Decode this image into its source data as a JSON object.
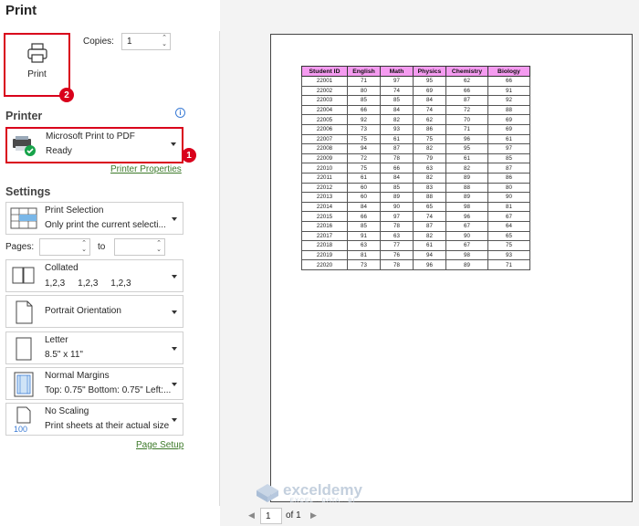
{
  "header": {
    "title": "Print"
  },
  "print_button": {
    "label": "Print"
  },
  "badges": {
    "b1": "1",
    "b2": "2"
  },
  "copies": {
    "label": "Copies:",
    "value": "1"
  },
  "printer": {
    "section": "Printer",
    "name": "Microsoft Print to PDF",
    "status": "Ready",
    "properties_link": "Printer Properties"
  },
  "settings": {
    "section": "Settings",
    "selection": {
      "title": "Print Selection",
      "subtitle": "Only print the current selecti..."
    },
    "pages": {
      "label": "Pages:",
      "to": "to",
      "from_value": "",
      "to_value": ""
    },
    "collation": {
      "title": "Collated",
      "subtitle": "1,2,3     1,2,3     1,2,3"
    },
    "orientation": {
      "title": "Portrait Orientation"
    },
    "paper": {
      "title": "Letter",
      "subtitle": "8.5\" x 11\""
    },
    "margins": {
      "title": "Normal Margins",
      "subtitle": "Top: 0.75\" Bottom: 0.75\" Left:..."
    },
    "scaling": {
      "title": "No Scaling",
      "subtitle": "Print sheets at their actual size",
      "icon_text": "100"
    },
    "page_setup_link": "Page Setup"
  },
  "pager": {
    "current": "1",
    "of_label": "of 1"
  },
  "watermark": {
    "brand": "exceldemy",
    "tagline": "EXCEL · DATA · BI"
  },
  "colors": {
    "accent_red": "#d9001b",
    "header_fill": "#f59bf0",
    "link_green": "#3d7a2a"
  },
  "table": {
    "headers": [
      "Student ID",
      "English",
      "Math",
      "Physics",
      "Chemistry",
      "Biology"
    ],
    "rows": [
      [
        "22001",
        "71",
        "97",
        "95",
        "62",
        "66"
      ],
      [
        "22002",
        "80",
        "74",
        "69",
        "66",
        "91"
      ],
      [
        "22003",
        "85",
        "85",
        "84",
        "87",
        "92"
      ],
      [
        "22004",
        "66",
        "84",
        "74",
        "72",
        "88"
      ],
      [
        "22005",
        "92",
        "82",
        "62",
        "70",
        "69"
      ],
      [
        "22006",
        "73",
        "93",
        "86",
        "71",
        "69"
      ],
      [
        "22007",
        "75",
        "61",
        "75",
        "96",
        "61"
      ],
      [
        "22008",
        "94",
        "87",
        "82",
        "95",
        "97"
      ],
      [
        "22009",
        "72",
        "78",
        "79",
        "61",
        "85"
      ],
      [
        "22010",
        "75",
        "66",
        "63",
        "82",
        "87"
      ],
      [
        "22011",
        "61",
        "84",
        "82",
        "89",
        "86"
      ],
      [
        "22012",
        "60",
        "85",
        "83",
        "88",
        "80"
      ],
      [
        "22013",
        "60",
        "89",
        "88",
        "89",
        "90"
      ],
      [
        "22014",
        "84",
        "90",
        "65",
        "98",
        "81"
      ],
      [
        "22015",
        "66",
        "97",
        "74",
        "96",
        "67"
      ],
      [
        "22016",
        "85",
        "78",
        "87",
        "67",
        "64"
      ],
      [
        "22017",
        "91",
        "63",
        "82",
        "90",
        "65"
      ],
      [
        "22018",
        "63",
        "77",
        "61",
        "67",
        "75"
      ],
      [
        "22019",
        "81",
        "76",
        "94",
        "98",
        "93"
      ],
      [
        "22020",
        "73",
        "78",
        "96",
        "89",
        "71"
      ]
    ]
  }
}
